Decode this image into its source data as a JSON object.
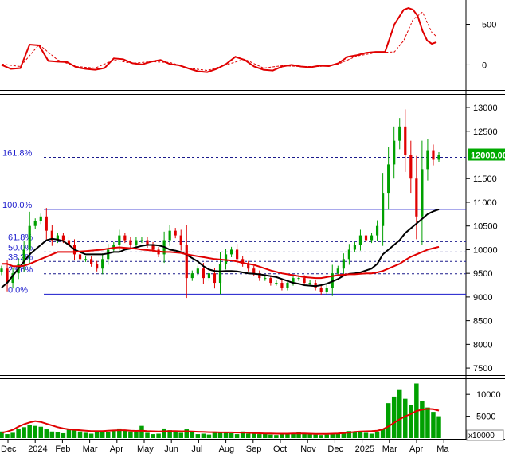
{
  "chart_data": [
    {
      "type": "line",
      "panel": "indicator",
      "ylim": [
        -300,
        780
      ],
      "yticks": [
        0,
        500
      ],
      "zero_line": "dashed",
      "series": [
        {
          "color": "#e00000",
          "style": "solid",
          "x": [
            0,
            2,
            4,
            6,
            8,
            10,
            12,
            14,
            16,
            18,
            20,
            22,
            24,
            26,
            28,
            30,
            32,
            34,
            36,
            38,
            40,
            42,
            44,
            46,
            48,
            50,
            52,
            54,
            56,
            58,
            60,
            62,
            64,
            66,
            68,
            70,
            72,
            74,
            76,
            78,
            80,
            82,
            84,
            85,
            86,
            87,
            88,
            89,
            90,
            91,
            92,
            93
          ],
          "values": [
            0,
            -50,
            -40,
            250,
            240,
            50,
            40,
            35,
            -30,
            -50,
            -60,
            -40,
            80,
            70,
            20,
            5,
            40,
            60,
            10,
            -5,
            -45,
            -80,
            -90,
            -50,
            10,
            100,
            60,
            -20,
            -60,
            -70,
            -20,
            0,
            -20,
            -30,
            -10,
            -15,
            20,
            100,
            120,
            150,
            160,
            160,
            500,
            590,
            680,
            700,
            680,
            600,
            420,
            300,
            260,
            280
          ]
        },
        {
          "color": "#e00000",
          "style": "dashed",
          "x": [
            0,
            4,
            8,
            12,
            16,
            20,
            24,
            28,
            32,
            36,
            40,
            44,
            48,
            52,
            56,
            60,
            64,
            68,
            72,
            76,
            80,
            84,
            86,
            88,
            90,
            92,
            93
          ],
          "values": [
            10,
            -20,
            250,
            60,
            -20,
            -40,
            60,
            20,
            40,
            30,
            -40,
            -70,
            0,
            70,
            -40,
            -10,
            -20,
            -20,
            10,
            110,
            150,
            160,
            300,
            560,
            650,
            400,
            350
          ]
        }
      ]
    },
    {
      "type": "candlestick",
      "panel": "price",
      "ylim": [
        7350,
        13270
      ],
      "yticks": [
        7500,
        8000,
        8500,
        9000,
        9500,
        10000,
        10500,
        11000,
        11500,
        12000,
        12500,
        13000
      ],
      "last_price_label": "12000.00",
      "last_price": 12000,
      "fib_levels": [
        {
          "label": "161.8%",
          "value": 11950
        },
        {
          "label": "100.0%",
          "value": 10850
        },
        {
          "label": "61.8%",
          "value": 10170
        },
        {
          "label": "50.0%",
          "value": 9950
        },
        {
          "label": "38.2%",
          "value": 9750
        },
        {
          "label": "23.6%",
          "value": 9490
        },
        {
          "label": "0.0%",
          "value": 9060
        }
      ],
      "close": [
        9600,
        9300,
        9500,
        9700,
        10000,
        10500,
        10600,
        10700,
        10400,
        10200,
        10300,
        10200,
        10100,
        9900,
        9800,
        9800,
        9700,
        9600,
        9800,
        10000,
        10100,
        10300,
        10200,
        10100,
        10200,
        10200,
        10100,
        10000,
        9900,
        10200,
        10400,
        10300,
        10100,
        9400,
        9500,
        9600,
        9400,
        9500,
        9300,
        9700,
        9900,
        10000,
        9800,
        9700,
        9600,
        9500,
        9400,
        9400,
        9300,
        9300,
        9200,
        9300,
        9400,
        9400,
        9300,
        9300,
        9200,
        9100,
        9200,
        9500,
        9600,
        9800,
        10000,
        10100,
        10300,
        10200,
        10300,
        10500,
        11200,
        11800,
        12300,
        12600,
        12000,
        11500,
        10700,
        11700,
        12100,
        11900,
        12000
      ],
      "line_series": [
        {
          "color": "#000000",
          "values": [
            9200,
            9300,
            9450,
            9600,
            9750,
            9900,
            10000,
            10100,
            10200,
            10230,
            10210,
            10180,
            10100,
            10000,
            9950,
            9900,
            9900,
            9900,
            9900,
            9920,
            9950,
            9950,
            10000,
            10020,
            10050,
            10080,
            10100,
            10100,
            10090,
            10060,
            10000,
            9980,
            9950,
            9890,
            9820,
            9750,
            9650,
            9580,
            9550,
            9540,
            9550,
            9550,
            9540,
            9520,
            9500,
            9490,
            9480,
            9460,
            9440,
            9420,
            9380,
            9340,
            9300,
            9280,
            9250,
            9240,
            9230,
            9250,
            9280,
            9330,
            9380,
            9450,
            9490,
            9500,
            9520,
            9560,
            9600,
            9700,
            9900,
            10000,
            10100,
            10200,
            10350,
            10450,
            10550,
            10650,
            10750,
            10810,
            10850
          ]
        },
        {
          "color": "#e00000",
          "values": [
            9700,
            9700,
            9650,
            9650,
            9660,
            9700,
            9750,
            9800,
            9850,
            9900,
            9950,
            9950,
            9950,
            9950,
            9960,
            9970,
            9980,
            9990,
            10000,
            10020,
            10040,
            10050,
            10040,
            10030,
            10020,
            10000,
            9990,
            9980,
            9960,
            9950,
            9950,
            9940,
            9930,
            9900,
            9880,
            9860,
            9840,
            9820,
            9800,
            9790,
            9780,
            9770,
            9750,
            9720,
            9700,
            9680,
            9640,
            9600,
            9560,
            9530,
            9500,
            9480,
            9460,
            9440,
            9420,
            9410,
            9400,
            9400,
            9420,
            9440,
            9460,
            9470,
            9480,
            9480,
            9490,
            9500,
            9500,
            9520,
            9550,
            9600,
            9650,
            9700,
            9780,
            9850,
            9900,
            9950,
            10000,
            10030,
            10060
          ]
        }
      ]
    },
    {
      "type": "bar",
      "panel": "volume",
      "ylim": [
        0,
        13500
      ],
      "yticks": [
        5000,
        10000
      ],
      "unit_label": "x10000",
      "values": [
        1500,
        900,
        1200,
        2000,
        2500,
        3000,
        2800,
        2600,
        2000,
        1500,
        1300,
        1100,
        2000,
        1800,
        1500,
        1200,
        1000,
        1400,
        1600,
        1300,
        1900,
        2200,
        1700,
        1500,
        1400,
        2800,
        1200,
        900,
        1000,
        2200,
        1800,
        1500,
        1200,
        2000,
        1500,
        900,
        1000,
        800,
        1400,
        1200,
        1300,
        1100,
        900,
        1500,
        1000,
        1200,
        900,
        1000,
        800,
        700,
        900,
        1000,
        1100,
        1300,
        1000,
        900,
        800,
        700,
        800,
        1000,
        1100,
        1400,
        1600,
        1500,
        1300,
        1200,
        1000,
        1500,
        2000,
        8000,
        9500,
        11000,
        9000,
        7500,
        12500,
        8500,
        7000,
        6000,
        5000
      ],
      "ma_values": [
        1200,
        1500,
        1900,
        2600,
        3200,
        3600,
        3900,
        3700,
        3300,
        2900,
        2500,
        2200,
        2000,
        1900,
        1800,
        1700,
        1600,
        1600,
        1600,
        1700,
        1750,
        1800,
        1800,
        1700,
        1650,
        1700,
        1600,
        1550,
        1500,
        1550,
        1600,
        1600,
        1550,
        1550,
        1500,
        1450,
        1400,
        1350,
        1350,
        1300,
        1300,
        1300,
        1250,
        1250,
        1200,
        1150,
        1100,
        1050,
        1050,
        1000,
        1000,
        1000,
        1050,
        1050,
        1050,
        1000,
        950,
        950,
        950,
        1000,
        1050,
        1150,
        1250,
        1400,
        1500,
        1550,
        1600,
        1700,
        2000,
        2700,
        3500,
        4300,
        5000,
        5500,
        6200,
        6500,
        6700,
        6600,
        6300
      ]
    }
  ],
  "x_axis": {
    "labels": [
      "Dec",
      "2024",
      "Feb",
      "Mar",
      "Apr",
      "May",
      "Jun",
      "Jul",
      "Aug",
      "Sep",
      "Oct",
      "Nov",
      "Dec",
      "2025",
      "Mar",
      "Apr",
      "Ma"
    ]
  },
  "colors": {
    "up": "#00a000",
    "down": "#e00000",
    "fib": "#1a1acc",
    "price_tag_bg": "#00aa00"
  }
}
